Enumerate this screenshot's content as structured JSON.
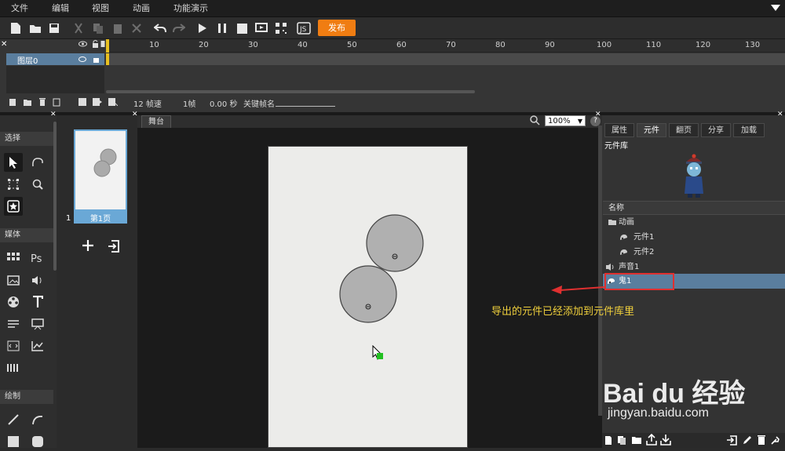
{
  "menu": [
    "文件",
    "编辑",
    "视图",
    "动画",
    "功能演示"
  ],
  "toolbar": {
    "publish": "发布"
  },
  "timeline": {
    "ticks": [
      "10",
      "20",
      "30",
      "40",
      "50",
      "60",
      "70",
      "80",
      "90",
      "100",
      "110",
      "120",
      "130"
    ],
    "layer_name": "图层0",
    "fps": "12 帧速",
    "frame": "1帧",
    "time": "0.00 秒",
    "keyframe_label": "关键帧名"
  },
  "tools": {
    "select_header": "选择",
    "media_header": "媒体",
    "draw_header": "绘制"
  },
  "pages": {
    "page_number": "1",
    "page_label": "第1页"
  },
  "stage": {
    "tab": "舞台",
    "zoom": "100%"
  },
  "panel": {
    "tabs": [
      "属性",
      "元件",
      "翻页",
      "分享",
      "加载"
    ],
    "library_title": "元件库",
    "column_name": "名称",
    "items": [
      {
        "label": "动画",
        "kind": "folder"
      },
      {
        "label": "元件1",
        "kind": "symbol"
      },
      {
        "label": "元件2",
        "kind": "symbol"
      },
      {
        "label": "声音1",
        "kind": "sound"
      },
      {
        "label": "鬼1",
        "kind": "symbol"
      }
    ]
  },
  "annotation": "导出的元件已经添加到元件库里",
  "watermark": {
    "brand": "Bai du 经验",
    "url": "jingyan.baidu.com"
  },
  "colors": {
    "accent": "#f07d12",
    "selection": "#5a7e9e",
    "annotation": "#f0d03c",
    "highlight": "#e03030"
  }
}
